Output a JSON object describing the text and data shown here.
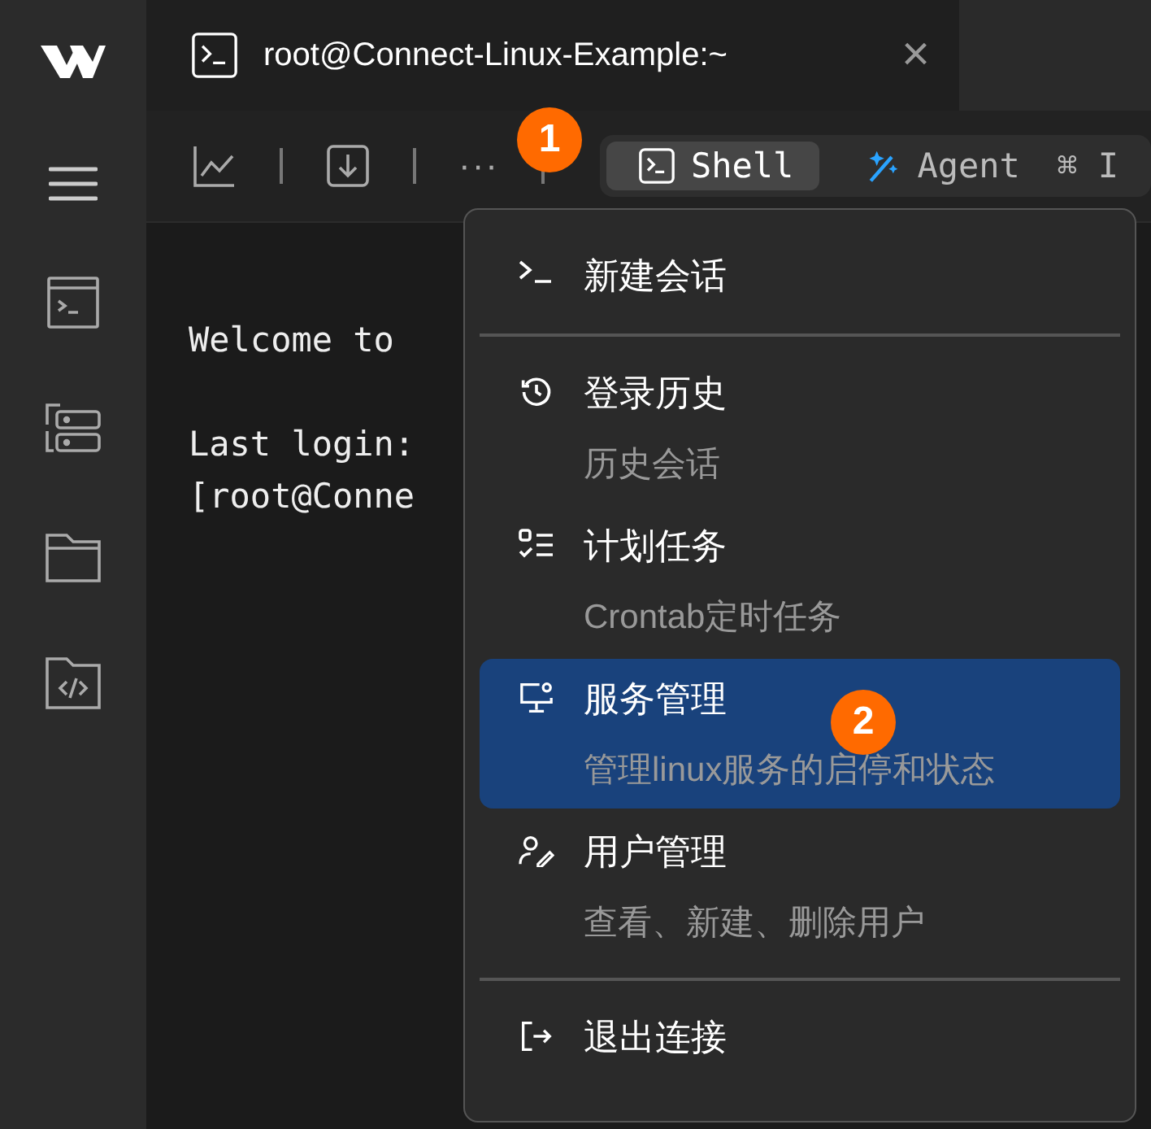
{
  "tab": {
    "title": "root@Connect-Linux-Example:~",
    "close": "×"
  },
  "toolbar": {
    "more": "···",
    "modes": [
      {
        "label": "Shell",
        "selected": true,
        "kind": "shell"
      },
      {
        "label": "Agent",
        "shortcut": "⌘ I",
        "selected": false,
        "kind": "agent"
      }
    ]
  },
  "terminal": {
    "blocks": [
      [
        "Welcome to"
      ],
      [
        "Last login:",
        "[root@Conne"
      ]
    ]
  },
  "menu": {
    "sections": [
      [
        {
          "kind": "new",
          "label": "新建会话",
          "selected": false
        }
      ],
      [
        {
          "kind": "history",
          "label": "登录历史",
          "description": "历史会话",
          "selected": false
        },
        {
          "kind": "tasks",
          "label": "计划任务",
          "description": "Crontab定时任务",
          "selected": false
        },
        {
          "kind": "services",
          "label": "服务管理",
          "description": "管理linux服务的启停和状态",
          "selected": true
        },
        {
          "kind": "users",
          "label": "用户管理",
          "description": "查看、新建、删除用户",
          "selected": false
        }
      ],
      [
        {
          "kind": "exit",
          "label": "退出连接",
          "selected": false
        }
      ]
    ]
  },
  "callouts": [
    "1",
    "2"
  ]
}
